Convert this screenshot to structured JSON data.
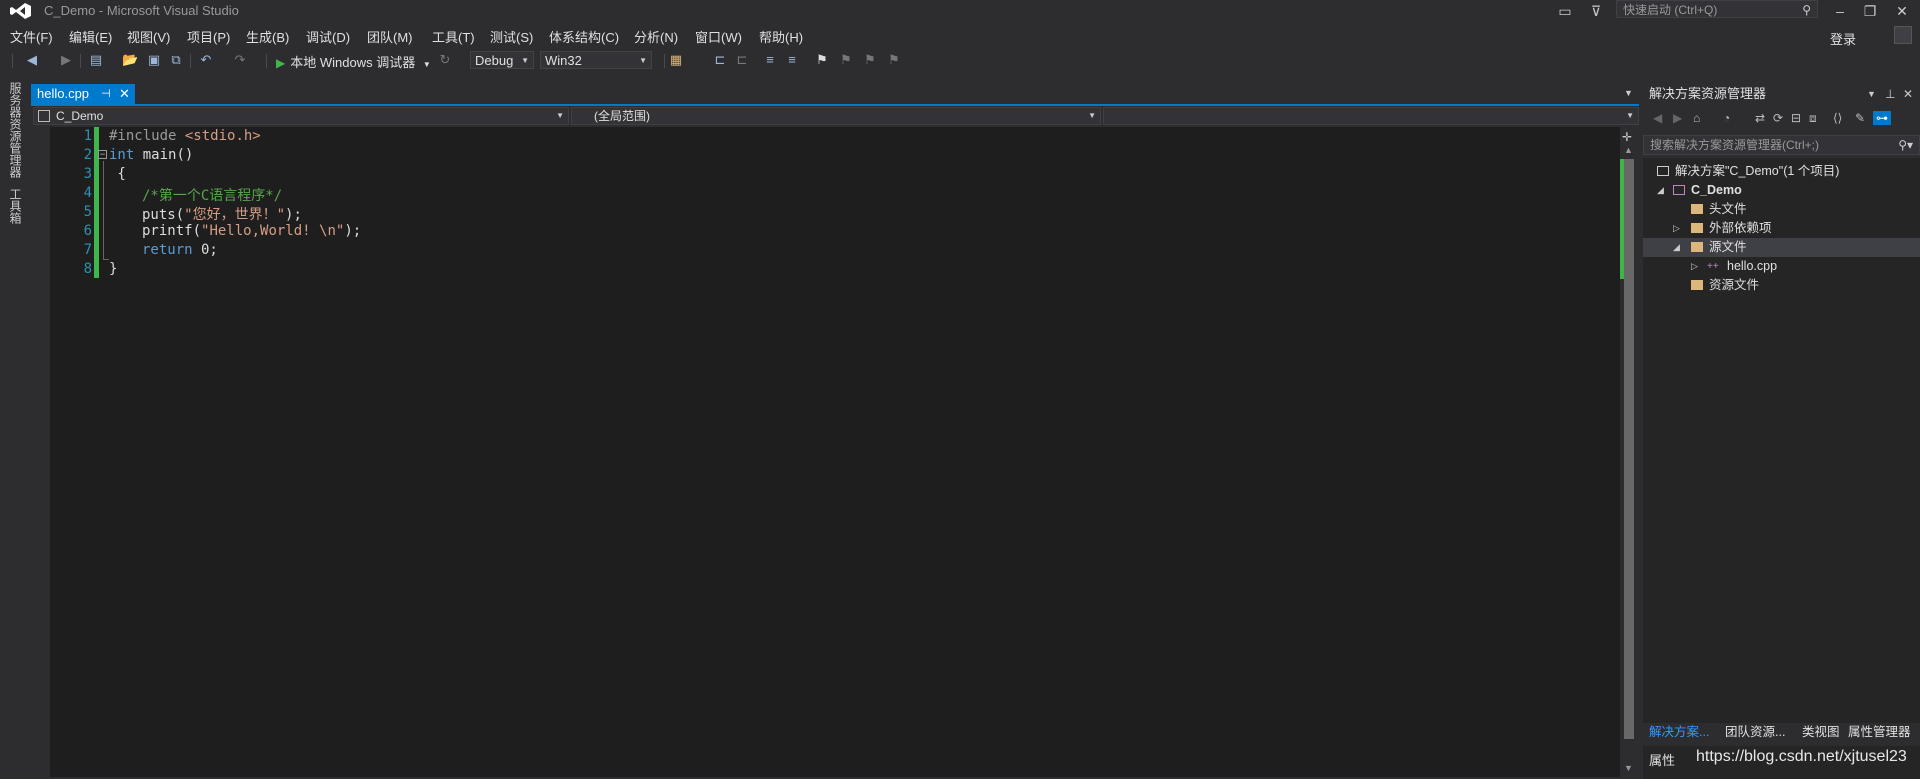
{
  "window": {
    "title": "C_Demo - Microsoft Visual Studio",
    "quick_launch_placeholder": "快速启动 (Ctrl+Q)",
    "login_label": "登录"
  },
  "menu": [
    "文件(F)",
    "编辑(E)",
    "视图(V)",
    "项目(P)",
    "生成(B)",
    "调试(D)",
    "团队(M)",
    "工具(T)",
    "测试(S)",
    "体系结构(C)",
    "分析(N)",
    "窗口(W)",
    "帮助(H)"
  ],
  "toolbar": {
    "run_label": "本地 Windows 调试器",
    "config": "Debug",
    "platform": "Win32"
  },
  "side_tabs": [
    "服务器资源管理器",
    "工具箱"
  ],
  "editor": {
    "tab_label": "hello.cpp",
    "scope_left": "C_Demo",
    "scope_middle": "(全局范围)",
    "line_numbers": [
      "1",
      "2",
      "3",
      "4",
      "5",
      "6",
      "7",
      "8"
    ],
    "code": {
      "l1_directive": "#include",
      "l1_header": " <stdio.h>",
      "l2_kw": "int",
      "l2_rest": " main()",
      "l3": " {",
      "l4_comment": "/*第一个C语言程序*/",
      "l5_pre": "puts(",
      "l5_str": "\"您好，世界！\"",
      "l5_post": ");",
      "l6_pre": "printf(",
      "l6_str": "\"Hello,World! \\n\"",
      "l6_post": ");",
      "l7_kw": "return",
      "l7_rest": " 0;",
      "l8": "}"
    }
  },
  "solution_explorer": {
    "title": "解决方案资源管理器",
    "search_placeholder": "搜索解决方案资源管理器(Ctrl+;)",
    "tree": {
      "solution": "解决方案\"C_Demo\"(1 个项目)",
      "project": "C_Demo",
      "headers": "头文件",
      "external": "外部依赖项",
      "sources": "源文件",
      "hello": "hello.cpp",
      "resources": "资源文件"
    },
    "bottom_tabs": [
      "解决方案...",
      "团队资源...",
      "类视图",
      "属性管理器"
    ],
    "properties_title": "属性"
  },
  "watermark": "https://blog.csdn.net/xjtusel23",
  "colors": {
    "accent": "#007acc",
    "keyword": "#569cd6",
    "string": "#d69d85",
    "comment": "#57a64a",
    "line_number": "#2b91af",
    "change_bar": "#3fb64a"
  }
}
